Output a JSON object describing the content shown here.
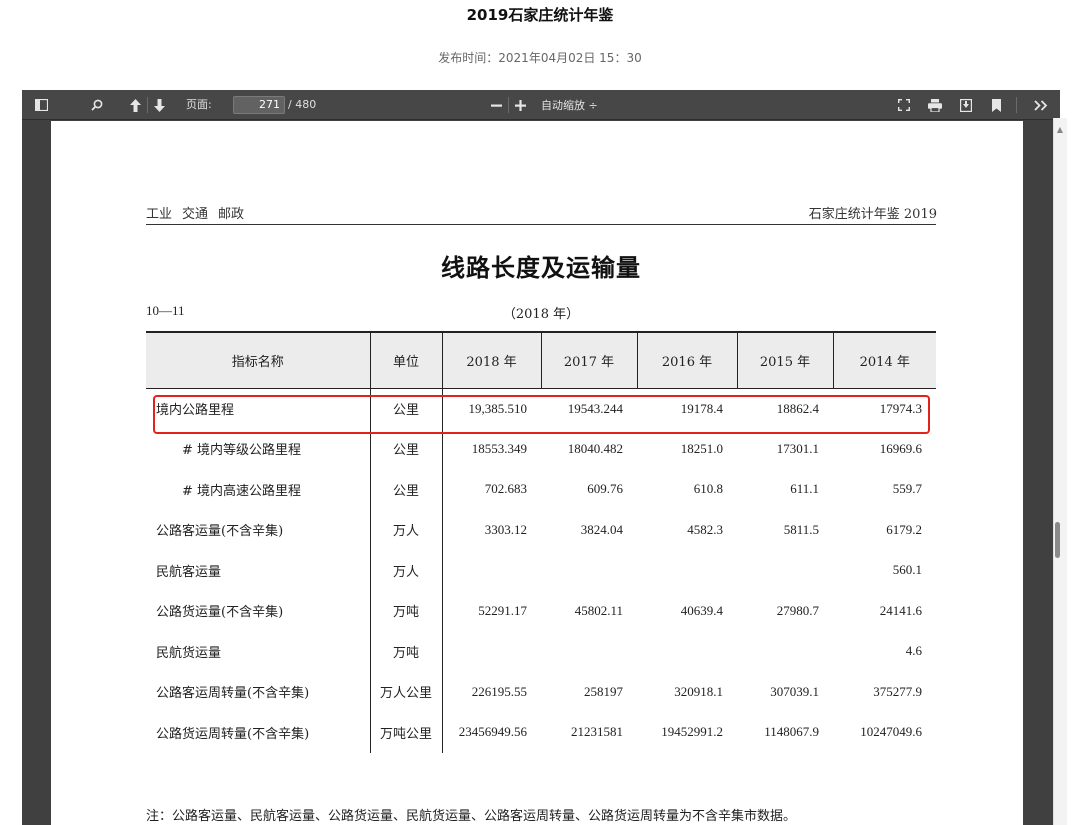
{
  "site": {
    "title": "2019石家庄统计年鉴",
    "publish_time": "发布时间：2021年04月02日 15：30"
  },
  "toolbar": {
    "page_label": "页面:",
    "page_current": "271",
    "page_total": "/ 480",
    "zoom": "自动缩放 ÷",
    "icons": [
      "sidebar-toggle-icon",
      "search-icon",
      "arrow-up-icon",
      "arrow-down-icon",
      "zoom-out-icon",
      "zoom-in-icon",
      "fullscreen-icon",
      "print-icon",
      "download-icon",
      "bookmark-icon",
      "more-tools-icon"
    ]
  },
  "doc": {
    "header_left": [
      "工业",
      "交通",
      "邮政"
    ],
    "header_right": "石家庄统计年鉴 2019",
    "table_title": "线路长度及运输量",
    "table_no": "10—11",
    "table_year": "（2018 年）",
    "columns": [
      "指标名称",
      "单位",
      "2018 年",
      "2017 年",
      "2016 年",
      "2015 年",
      "2014 年"
    ],
    "rows": [
      {
        "name": "境内公路里程",
        "unit": "公里",
        "values": [
          "19,385.510",
          "19543.244",
          "19178.4",
          "18862.4",
          "17974.3"
        ]
      },
      {
        "name": "# 境内等级公路里程",
        "unit": "公里",
        "values": [
          "18553.349",
          "18040.482",
          "18251.0",
          "17301.1",
          "16969.6"
        ]
      },
      {
        "name": "# 境内高速公路里程",
        "unit": "公里",
        "values": [
          "702.683",
          "609.76",
          "610.8",
          "611.1",
          "559.7"
        ]
      },
      {
        "name": "公路客运量(不含辛集)",
        "unit": "万人",
        "values": [
          "3303.12",
          "3824.04",
          "4582.3",
          "5811.5",
          "6179.2"
        ]
      },
      {
        "name": "民航客运量",
        "unit": "万人",
        "values": [
          "",
          "",
          "",
          "",
          "560.1"
        ]
      },
      {
        "name": "公路货运量(不含辛集)",
        "unit": "万吨",
        "values": [
          "52291.17",
          "45802.11",
          "40639.4",
          "27980.7",
          "24141.6"
        ]
      },
      {
        "name": "民航货运量",
        "unit": "万吨",
        "values": [
          "",
          "",
          "",
          "",
          "4.6"
        ]
      },
      {
        "name": "公路客运周转量(不含辛集)",
        "unit": "万人公里",
        "values": [
          "226195.55",
          "258197",
          "320918.1",
          "307039.1",
          "375277.9"
        ]
      },
      {
        "name": "公路货运周转量(不含辛集)",
        "unit": "万吨公里",
        "values": [
          "23456949.56",
          "21231581",
          "19452991.2",
          "1148067.9",
          "10247049.6"
        ]
      }
    ],
    "note": "注：公路客运量、民航客运量、公路货运量、民航货运量、公路客运周转量、公路货运周转量为不含辛集市数据。"
  },
  "colors": {
    "highlight": "#e0241c",
    "toolbar_bg": "#474747",
    "viewer_bg": "#404040"
  }
}
